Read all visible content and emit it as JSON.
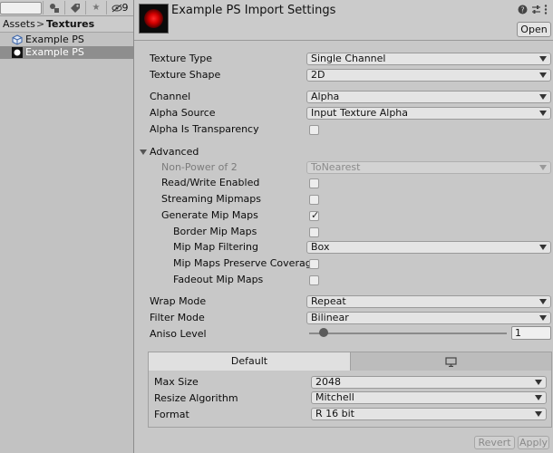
{
  "project": {
    "breadcrumb": {
      "root": "Assets",
      "separator": ">",
      "current": "Textures"
    },
    "toolbar": {
      "hidden_count": "9"
    },
    "files": [
      {
        "name": "Example PS",
        "icon": "prefab-cube-icon",
        "selected": false
      },
      {
        "name": "Example PS",
        "icon": "texture-thumbnail-icon",
        "selected": true
      }
    ]
  },
  "inspector": {
    "title": "Example PS Import Settings",
    "open_button": "Open",
    "texture_type_label": "Texture Type",
    "texture_type_value": "Single Channel",
    "texture_shape_label": "Texture Shape",
    "texture_shape_value": "2D",
    "channel_label": "Channel",
    "channel_value": "Alpha",
    "alpha_source_label": "Alpha Source",
    "alpha_source_value": "Input Texture Alpha",
    "alpha_is_transparency_label": "Alpha Is Transparency",
    "alpha_is_transparency_checked": false,
    "advanced_label": "Advanced",
    "non_power_of_2_label": "Non-Power of 2",
    "non_power_of_2_value": "ToNearest",
    "read_write_label": "Read/Write Enabled",
    "read_write_checked": false,
    "streaming_mipmaps_label": "Streaming Mipmaps",
    "streaming_mipmaps_checked": false,
    "generate_mip_maps_label": "Generate Mip Maps",
    "generate_mip_maps_checked": true,
    "border_mip_maps_label": "Border Mip Maps",
    "border_mip_maps_checked": false,
    "mip_map_filtering_label": "Mip Map Filtering",
    "mip_map_filtering_value": "Box",
    "mip_maps_preserve_coverage_label": "Mip Maps Preserve Coverage",
    "mip_maps_preserve_coverage_checked": false,
    "fadeout_mip_maps_label": "Fadeout Mip Maps",
    "fadeout_mip_maps_checked": false,
    "wrap_mode_label": "Wrap Mode",
    "wrap_mode_value": "Repeat",
    "filter_mode_label": "Filter Mode",
    "filter_mode_value": "Bilinear",
    "aniso_level_label": "Aniso Level",
    "aniso_level_value": "1",
    "platform_tabs": {
      "default": "Default",
      "standalone_icon": "monitor-icon"
    },
    "max_size_label": "Max Size",
    "max_size_value": "2048",
    "resize_algorithm_label": "Resize Algorithm",
    "resize_algorithm_value": "Mitchell",
    "format_label": "Format",
    "format_value": "R 16 bit",
    "revert_button": "Revert",
    "apply_button": "Apply"
  }
}
